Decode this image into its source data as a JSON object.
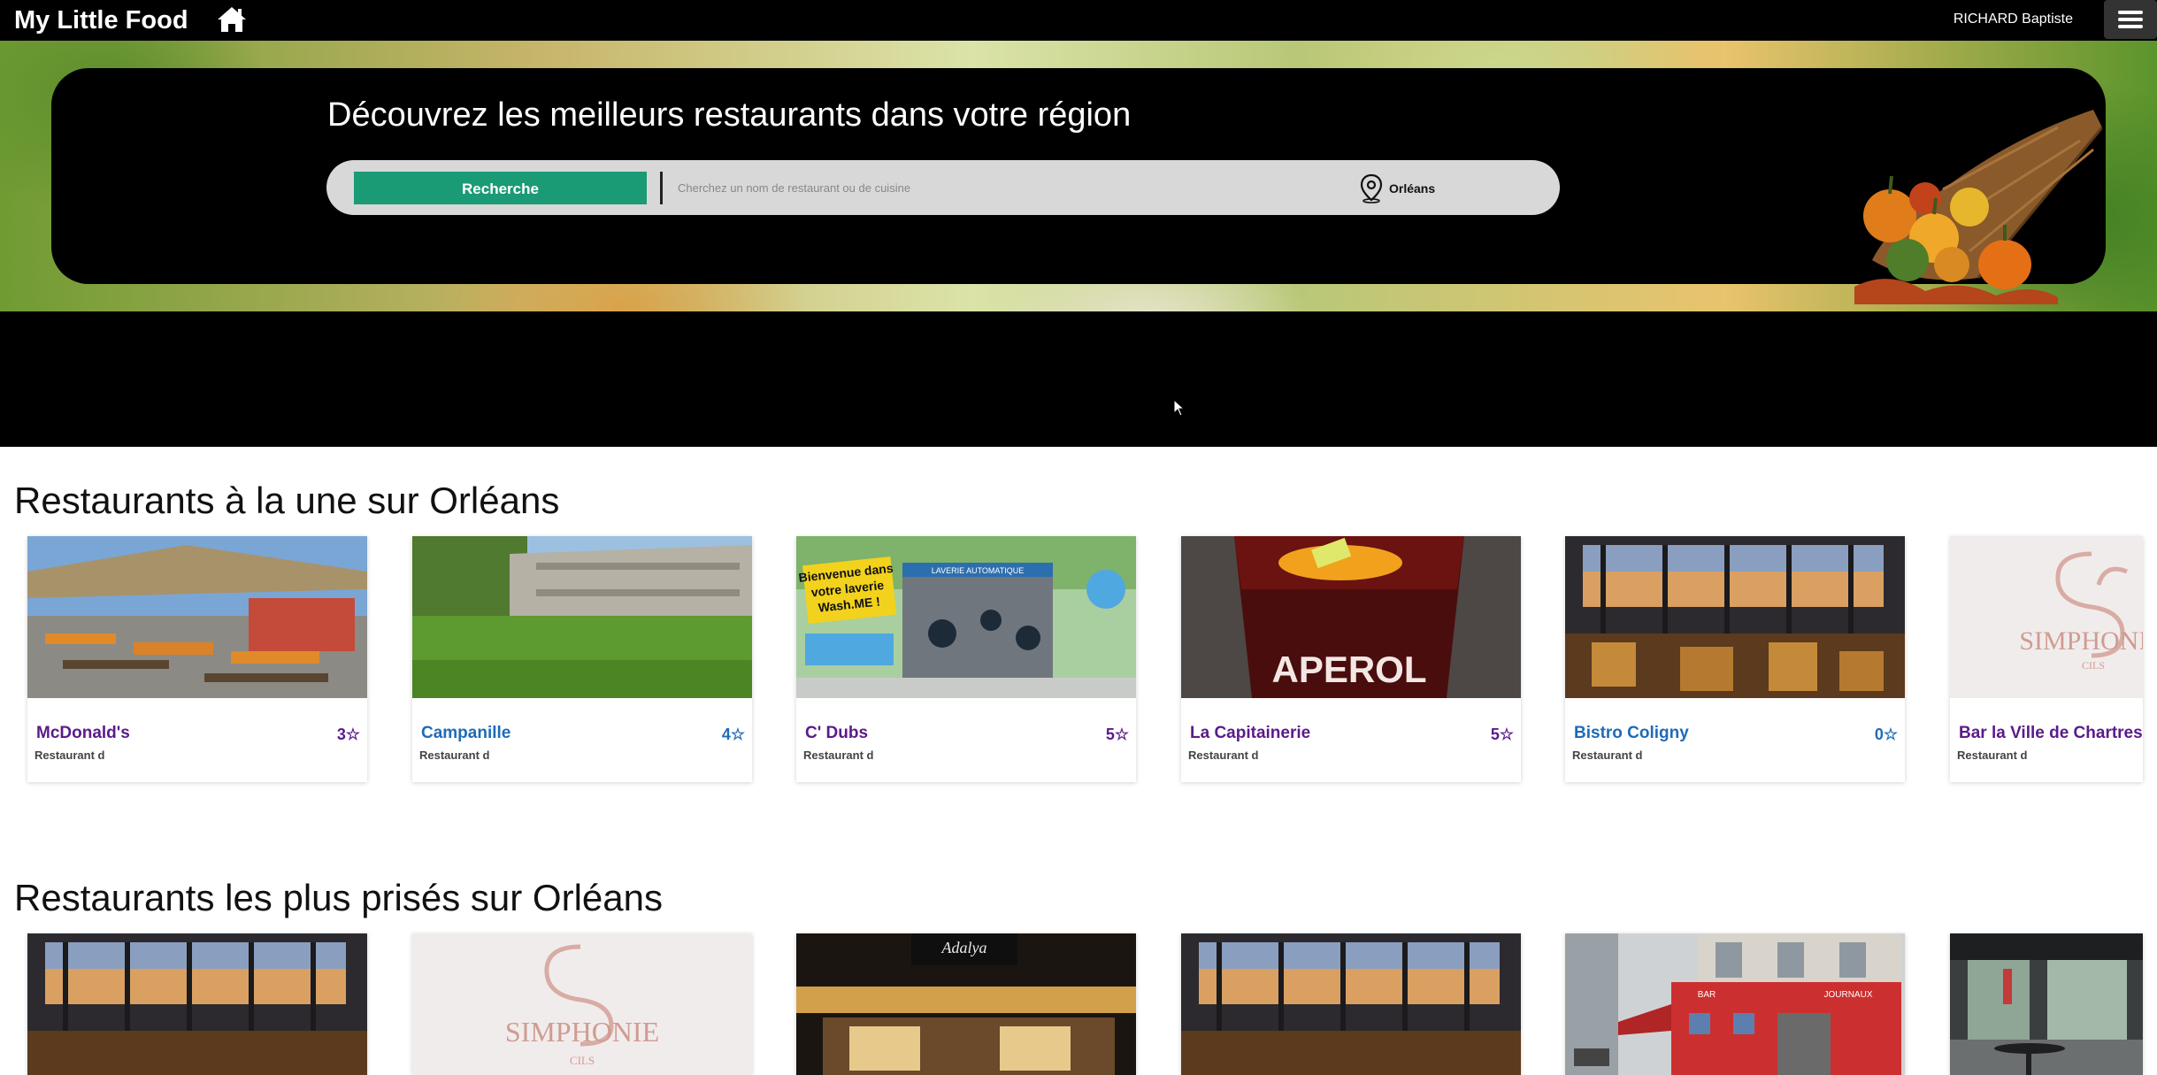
{
  "topbar": {
    "brand": "My Little Food",
    "home_icon": "home-icon",
    "user_name": "RICHARD Baptiste",
    "menu_icon": "hamburger-menu-icon",
    "background": "#000000"
  },
  "hero": {
    "title": "Découvrez les meilleurs restaurants dans votre région",
    "search_button": "Recherche",
    "search_placeholder": "Cherchez un nom de restaurant ou de cuisine",
    "location_icon": "map-pin-icon",
    "location": "Orléans",
    "accent": "#1b9a76"
  },
  "featured": {
    "title": "Restaurants à la une sur Orléans",
    "cards": [
      {
        "name": "McDonald's",
        "rating": "3☆",
        "subtitle": "Restaurant d",
        "color": "purple"
      },
      {
        "name": "Campanille",
        "rating": "4☆",
        "subtitle": "Restaurant d",
        "color": "blue"
      },
      {
        "name": "C' Dubs",
        "rating": "5☆",
        "subtitle": "Restaurant d",
        "color": "purple"
      },
      {
        "name": "La Capitainerie",
        "rating": "5☆",
        "subtitle": "Restaurant d",
        "color": "purple"
      },
      {
        "name": "Bistro Coligny",
        "rating": "0☆",
        "subtitle": "Restaurant d",
        "color": "blue"
      },
      {
        "name": "Bar la Ville de Chartres",
        "rating": "",
        "subtitle": "Restaurant d",
        "color": "purple"
      }
    ],
    "image_texts": {
      "laundry_line1": "Bienvenue dans",
      "laundry_line2": "votre laverie",
      "laundry_line3": "Wash.ME !",
      "laundry_sign": "LAVERIE AUTOMATIQUE",
      "aperol": "APEROL",
      "simphonie": "SIMPHONIE",
      "simphonie_sub": "CILS"
    }
  },
  "popular": {
    "title": "Restaurants les plus prisés sur Orléans",
    "image_texts": {
      "simphonie": "SIMPHONIE",
      "simphonie_sub": "CILS",
      "storefront_sign": "Adalya",
      "bar_sign": "BAR",
      "journaux_sign": "JOURNAUX"
    }
  }
}
